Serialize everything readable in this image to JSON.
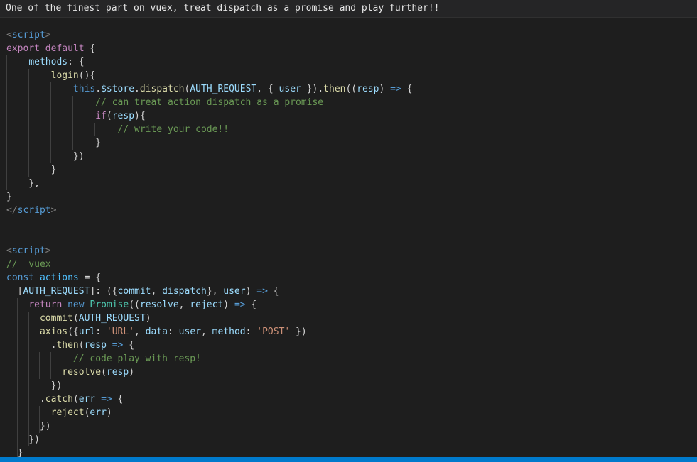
{
  "header": {
    "text": "One of the finest part on vuex, treat dispatch as a promise and play further!!"
  },
  "code": {
    "lines": [
      [
        [
          "tag",
          "<"
        ],
        [
          "tagname",
          "script"
        ],
        [
          "tag",
          ">"
        ]
      ],
      [
        [
          "kw-ctrl",
          "export"
        ],
        [
          "punc",
          " "
        ],
        [
          "kw-ctrl",
          "default"
        ],
        [
          "punc",
          " {"
        ]
      ],
      [
        [
          "punc",
          "    "
        ],
        [
          "prop",
          "methods"
        ],
        [
          "punc",
          ": {"
        ]
      ],
      [
        [
          "punc",
          "        "
        ],
        [
          "fn",
          "login"
        ],
        [
          "punc",
          "(){"
        ]
      ],
      [
        [
          "punc",
          "            "
        ],
        [
          "kw",
          "this"
        ],
        [
          "punc",
          "."
        ],
        [
          "prop",
          "$store"
        ],
        [
          "punc",
          "."
        ],
        [
          "fn",
          "dispatch"
        ],
        [
          "punc",
          "("
        ],
        [
          "prop",
          "AUTH_REQUEST"
        ],
        [
          "punc",
          ", { "
        ],
        [
          "prop",
          "user"
        ],
        [
          "punc",
          " })."
        ],
        [
          "fn",
          "then"
        ],
        [
          "punc",
          "(("
        ],
        [
          "prop",
          "resp"
        ],
        [
          "punc",
          ") "
        ],
        [
          "kw",
          "=>"
        ],
        [
          "punc",
          " {"
        ]
      ],
      [
        [
          "punc",
          "                "
        ],
        [
          "cmt",
          "// can treat action dispatch as a promise"
        ]
      ],
      [
        [
          "punc",
          "                "
        ],
        [
          "kw-ctrl",
          "if"
        ],
        [
          "punc",
          "("
        ],
        [
          "prop",
          "resp"
        ],
        [
          "punc",
          "){"
        ]
      ],
      [
        [
          "punc",
          "                    "
        ],
        [
          "cmt",
          "// write your code!!"
        ]
      ],
      [
        [
          "punc",
          "                }"
        ]
      ],
      [
        [
          "punc",
          "            })"
        ]
      ],
      [
        [
          "punc",
          "        }"
        ]
      ],
      [
        [
          "punc",
          "    },"
        ]
      ],
      [
        [
          "punc",
          "}"
        ]
      ],
      [
        [
          "tag",
          "</"
        ],
        [
          "tagname",
          "script"
        ],
        [
          "tag",
          ">"
        ]
      ],
      [],
      [],
      [
        [
          "tag",
          "<"
        ],
        [
          "tagname",
          "script"
        ],
        [
          "tag",
          ">"
        ]
      ],
      [
        [
          "cmt",
          "//  vuex"
        ]
      ],
      [
        [
          "kw",
          "const"
        ],
        [
          "punc",
          " "
        ],
        [
          "const",
          "actions"
        ],
        [
          "punc",
          " = {"
        ]
      ],
      [
        [
          "punc",
          "  ["
        ],
        [
          "prop",
          "AUTH_REQUEST"
        ],
        [
          "punc",
          "]: ({"
        ],
        [
          "prop",
          "commit"
        ],
        [
          "punc",
          ", "
        ],
        [
          "prop",
          "dispatch"
        ],
        [
          "punc",
          "}, "
        ],
        [
          "prop",
          "user"
        ],
        [
          "punc",
          ") "
        ],
        [
          "kw",
          "=>"
        ],
        [
          "punc",
          " {"
        ]
      ],
      [
        [
          "punc",
          "    "
        ],
        [
          "kw-ctrl",
          "return"
        ],
        [
          "punc",
          " "
        ],
        [
          "kw",
          "new"
        ],
        [
          "punc",
          " "
        ],
        [
          "cls",
          "Promise"
        ],
        [
          "punc",
          "(("
        ],
        [
          "prop",
          "resolve"
        ],
        [
          "punc",
          ", "
        ],
        [
          "prop",
          "reject"
        ],
        [
          "punc",
          ") "
        ],
        [
          "kw",
          "=>"
        ],
        [
          "punc",
          " {"
        ]
      ],
      [
        [
          "punc",
          "      "
        ],
        [
          "fn",
          "commit"
        ],
        [
          "punc",
          "("
        ],
        [
          "prop",
          "AUTH_REQUEST"
        ],
        [
          "punc",
          ")"
        ]
      ],
      [
        [
          "punc",
          "      "
        ],
        [
          "fn",
          "axios"
        ],
        [
          "punc",
          "({"
        ],
        [
          "prop",
          "url"
        ],
        [
          "punc",
          ": "
        ],
        [
          "str",
          "'URL'"
        ],
        [
          "punc",
          ", "
        ],
        [
          "prop",
          "data"
        ],
        [
          "punc",
          ": "
        ],
        [
          "prop",
          "user"
        ],
        [
          "punc",
          ", "
        ],
        [
          "prop",
          "method"
        ],
        [
          "punc",
          ": "
        ],
        [
          "str",
          "'POST'"
        ],
        [
          "punc",
          " })"
        ]
      ],
      [
        [
          "punc",
          "        ."
        ],
        [
          "fn",
          "then"
        ],
        [
          "punc",
          "("
        ],
        [
          "prop",
          "resp"
        ],
        [
          "punc",
          " "
        ],
        [
          "kw",
          "=>"
        ],
        [
          "punc",
          " {"
        ]
      ],
      [
        [
          "punc",
          "            "
        ],
        [
          "cmt",
          "// code play with resp!"
        ]
      ],
      [
        [
          "punc",
          "          "
        ],
        [
          "fn",
          "resolve"
        ],
        [
          "punc",
          "("
        ],
        [
          "prop",
          "resp"
        ],
        [
          "punc",
          ")"
        ]
      ],
      [
        [
          "punc",
          "        })"
        ]
      ],
      [
        [
          "punc",
          "      ."
        ],
        [
          "fn",
          "catch"
        ],
        [
          "punc",
          "("
        ],
        [
          "prop",
          "err"
        ],
        [
          "punc",
          " "
        ],
        [
          "kw",
          "=>"
        ],
        [
          "punc",
          " {"
        ]
      ],
      [
        [
          "punc",
          "        "
        ],
        [
          "fn",
          "reject"
        ],
        [
          "punc",
          "("
        ],
        [
          "prop",
          "err"
        ],
        [
          "punc",
          ")"
        ]
      ],
      [
        [
          "punc",
          "      })"
        ]
      ],
      [
        [
          "punc",
          "    })"
        ]
      ],
      [
        [
          "punc",
          "  }"
        ]
      ]
    ]
  }
}
